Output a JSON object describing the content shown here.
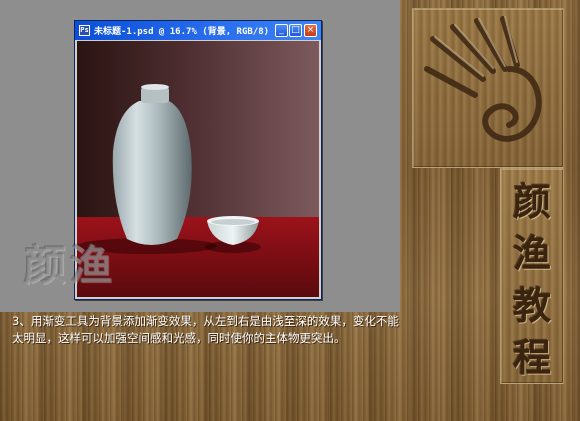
{
  "window": {
    "title": "未标题-1.psd @ 16.7% (背景, RGB/8)",
    "buttons": {
      "minimize": "_",
      "maximize": "□",
      "close": "×"
    },
    "app_icon": "Ps"
  },
  "watermark": "颜渔",
  "caption": "3、用渐变工具为背景添加渐变效果，从左到右是由浅至深的效果，变化不能太明显，这样可以加强空间感和光感，同时使你的主体物更突出。",
  "brand": {
    "chars": [
      "颜",
      "渔",
      "教",
      "程"
    ]
  },
  "colors": {
    "wood": "#86663a",
    "tablecloth": "#8a0f14",
    "titlebar": "#0a4fd6",
    "canvas_bg": "#8e8e8e"
  },
  "icons": {
    "logo": "spiral-hand-logo-icon",
    "app": "photoshop-doc-icon"
  }
}
